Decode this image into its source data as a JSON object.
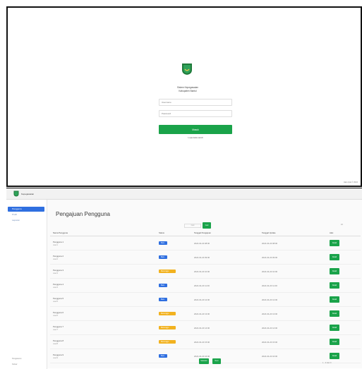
{
  "login": {
    "app_title": "Sistem Kepegawaian",
    "app_subtitle": "Kabupaten Bantul",
    "username_placeholder": "Username",
    "password_placeholder": "Password",
    "login_label": "Masuk",
    "forgot_label": "Lupa kata sandi",
    "copyright": "Hak cipta © 2024"
  },
  "admin": {
    "app_name": "Kepegawaian",
    "sidebar": [
      {
        "label": "Pengguna",
        "active": true
      },
      {
        "label": "Profil",
        "active": false
      },
      {
        "label": "Laporan",
        "active": false
      }
    ],
    "sidebar_footer": [
      "Pengaturan",
      "Keluar"
    ],
    "page_title": "Pengajuan Pengguna",
    "filter_placeholder": "Cari",
    "filter_button": "Cari",
    "rows_select": "10",
    "columns": [
      "Nama Pengguna",
      "Status",
      "Tanggal Pengajuan",
      "Tanggal Update",
      "Aksi"
    ],
    "rows": [
      {
        "name": "Pengguna 1",
        "user": "user1",
        "status": "Baru",
        "status_color": "#2f6fe0",
        "submitted": "2024-04-20 08:00",
        "updated": "2024-04-20 08:00",
        "action": "Detail"
      },
      {
        "name": "Pengguna 2",
        "user": "user2",
        "status": "Baru",
        "status_color": "#2f6fe0",
        "submitted": "2024-04-20 09:00",
        "updated": "2024-04-20 09:00",
        "action": "Detail"
      },
      {
        "name": "Pengguna 3",
        "user": "user3",
        "status": "Menunggu",
        "status_color": "#f2b21f",
        "submitted": "2024-04-20 10:00",
        "updated": "2024-04-20 10:00",
        "action": "Detail"
      },
      {
        "name": "Pengguna 4",
        "user": "user4",
        "status": "Baru",
        "status_color": "#2f6fe0",
        "submitted": "2024-04-20 11:00",
        "updated": "2024-04-20 11:00",
        "action": "Detail"
      },
      {
        "name": "Pengguna 5",
        "user": "user5",
        "status": "Baru",
        "status_color": "#2f6fe0",
        "submitted": "2024-04-20 12:00",
        "updated": "2024-04-20 12:00",
        "action": "Detail"
      },
      {
        "name": "Pengguna 6",
        "user": "user6",
        "status": "Menunggu",
        "status_color": "#f2b21f",
        "submitted": "2024-04-20 13:00",
        "updated": "2024-04-20 13:00",
        "action": "Detail"
      },
      {
        "name": "Pengguna 7",
        "user": "user7",
        "status": "Menunggu",
        "status_color": "#f2b21f",
        "submitted": "2024-04-20 14:00",
        "updated": "2024-04-20 14:00",
        "action": "Detail"
      },
      {
        "name": "Pengguna 8",
        "user": "user8",
        "status": "Menunggu",
        "status_color": "#f2b21f",
        "submitted": "2024-04-20 15:00",
        "updated": "2024-04-20 15:00",
        "action": "Detail"
      },
      {
        "name": "Pengguna 9",
        "user": "user9",
        "status": "Baru",
        "status_color": "#2f6fe0",
        "submitted": "2024-04-20 16:00",
        "updated": "2024-04-20 16:00",
        "action": "Detail"
      }
    ],
    "pager_prev": "Sebelum",
    "pager_next": "Next",
    "page_info": "1 - 9 dari 9"
  }
}
